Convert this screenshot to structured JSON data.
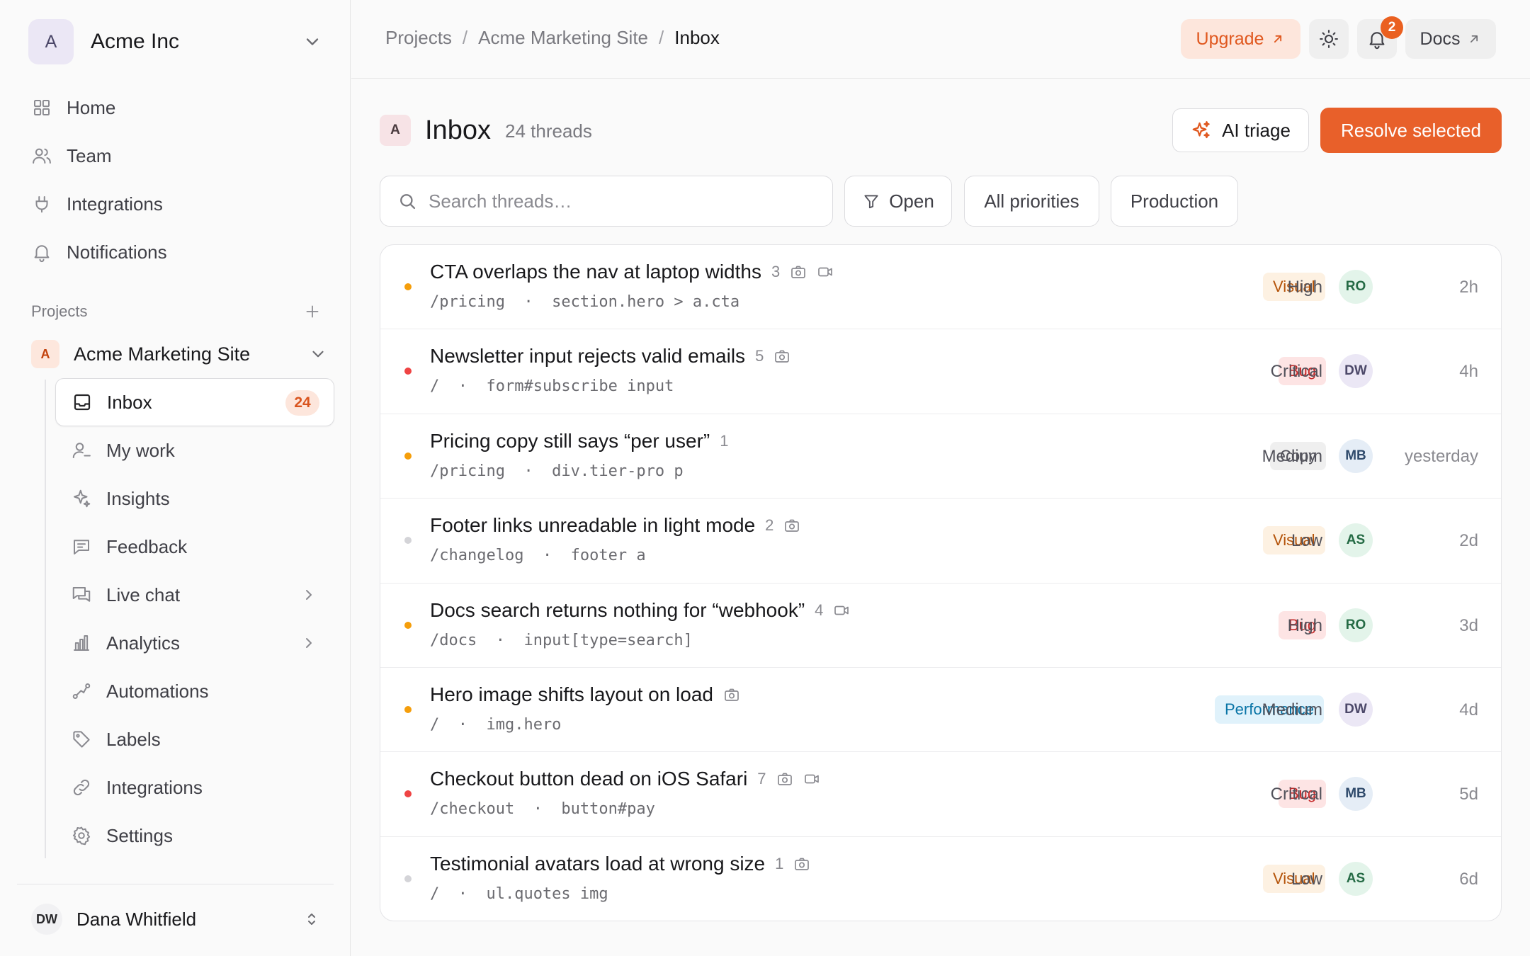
{
  "workspace": {
    "initial": "A",
    "name": "Acme Inc"
  },
  "nav": [
    {
      "label": "Home",
      "icon": "grid-icon"
    },
    {
      "label": "Team",
      "icon": "users-icon"
    },
    {
      "label": "Integrations",
      "icon": "plug-icon"
    },
    {
      "label": "Notifications",
      "icon": "bell-icon"
    }
  ],
  "projects_section": {
    "label": "Projects"
  },
  "project": {
    "initial": "A",
    "name": "Acme Marketing Site",
    "items": [
      {
        "label": "Inbox",
        "icon": "inbox-icon",
        "badge": "24",
        "active": true
      },
      {
        "label": "My work",
        "icon": "user-check-icon"
      },
      {
        "label": "Insights",
        "icon": "sparkles-icon"
      },
      {
        "label": "Feedback",
        "icon": "message-square-icon"
      },
      {
        "label": "Live chat",
        "icon": "messages-icon",
        "expandable": true
      },
      {
        "label": "Analytics",
        "icon": "bar-chart-icon",
        "expandable": true
      },
      {
        "label": "Automations",
        "icon": "workflow-icon"
      },
      {
        "label": "Labels",
        "icon": "tag-icon"
      },
      {
        "label": "Integrations",
        "icon": "link-icon"
      },
      {
        "label": "Settings",
        "icon": "gear-icon"
      }
    ]
  },
  "user": {
    "initials": "DW",
    "name": "Dana Whitfield"
  },
  "topbar": {
    "breadcrumb": [
      "Projects",
      "Acme Marketing Site",
      "Inbox"
    ],
    "upgrade_label": "Upgrade",
    "notifications_count": "2",
    "docs_label": "Docs"
  },
  "page": {
    "logo_initial": "A",
    "title": "Inbox",
    "count": "24 threads",
    "ai_triage_label": "AI triage",
    "resolve_label": "Resolve selected"
  },
  "filters": {
    "search_placeholder": "Search threads…",
    "status": "Open",
    "priority": "All priorities",
    "environment": "Production"
  },
  "colors": {
    "accent": "#e8602a",
    "priority_high": "#f59e0b",
    "priority_critical": "#ef4444",
    "priority_low": "#d4d4d8"
  },
  "threads": [
    {
      "title": "CTA overlaps the nav at laptop widths",
      "count": "3",
      "media": [
        "camera",
        "video"
      ],
      "path": "/pricing  ·  section.hero > a.cta",
      "label": "Visual",
      "priority": "High",
      "assignee": "RO",
      "time": "2h"
    },
    {
      "title": "Newsletter input rejects valid emails",
      "count": "5",
      "media": [
        "camera"
      ],
      "path": "/  ·  form#subscribe input",
      "label": "Bug",
      "priority": "Critical",
      "assignee": "DW",
      "time": "4h"
    },
    {
      "title": "Pricing copy still says “per user”",
      "count": "1",
      "media": [],
      "path": "/pricing  ·  div.tier-pro p",
      "label": "Copy",
      "priority": "Medium",
      "assignee": "MB",
      "time": "yesterday"
    },
    {
      "title": "Footer links unreadable in light mode",
      "count": "2",
      "media": [
        "camera"
      ],
      "path": "/changelog  ·  footer a",
      "label": "Visual",
      "priority": "Low",
      "assignee": "AS",
      "time": "2d"
    },
    {
      "title": "Docs search returns nothing for “webhook”",
      "count": "4",
      "media": [
        "video"
      ],
      "path": "/docs  ·  input[type=search]",
      "label": "Bug",
      "priority": "High",
      "assignee": "RO",
      "time": "3d"
    },
    {
      "title": "Hero image shifts layout on load",
      "count": "",
      "media": [
        "camera"
      ],
      "path": "/  ·  img.hero",
      "label": "Performance",
      "priority": "Medium",
      "assignee": "DW",
      "time": "4d"
    },
    {
      "title": "Checkout button dead on iOS Safari",
      "count": "7",
      "media": [
        "camera",
        "video"
      ],
      "path": "/checkout  ·  button#pay",
      "label": "Bug",
      "priority": "Critical",
      "assignee": "MB",
      "time": "5d"
    },
    {
      "title": "Testimonial avatars load at wrong size",
      "count": "1",
      "media": [
        "camera"
      ],
      "path": "/  ·  ul.quotes img",
      "label": "Visual",
      "priority": "Low",
      "assignee": "AS",
      "time": "6d"
    }
  ]
}
